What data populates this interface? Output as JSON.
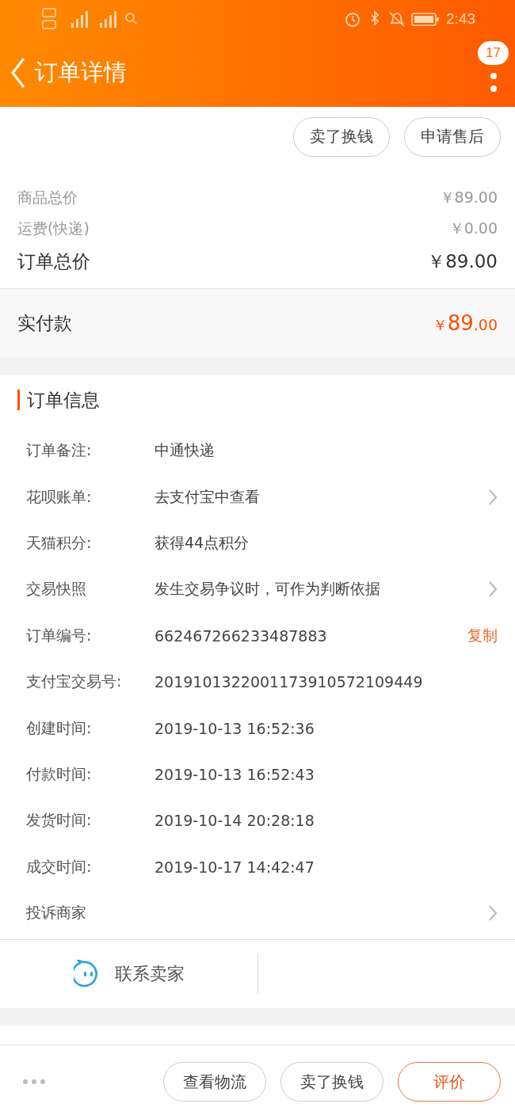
{
  "status_bar": {
    "time": "2:43"
  },
  "header": {
    "title": "订单详情",
    "badge": "17"
  },
  "top_actions": [
    "卖了换钱",
    "申请售后"
  ],
  "prices": [
    {
      "label": "商品总价",
      "value": "￥89.00",
      "kind": "minor"
    },
    {
      "label": "运费(快递)",
      "value": "￥0.00",
      "kind": "minor"
    },
    {
      "label": "订单总价",
      "value": "￥89.00",
      "kind": "major"
    }
  ],
  "paid": {
    "label": "实付款",
    "currency": "￥",
    "integer": "89",
    "decimal": ".00"
  },
  "order_info": {
    "title": "订单信息",
    "rows": [
      {
        "label": "订单备注:",
        "value": "中通快递",
        "kind": "plain"
      },
      {
        "label": "花呗账单:",
        "value": "去支付宝中查看",
        "kind": "link"
      },
      {
        "label": "天猫积分:",
        "value": "获得44点积分",
        "kind": "plain"
      },
      {
        "label": "交易快照",
        "value": "发生交易争议时，可作为判断依据",
        "kind": "link"
      },
      {
        "label": "订单编号:",
        "value": "662467266233487883",
        "kind": "copy",
        "action": "复制"
      },
      {
        "label": "支付宝交易号:",
        "value": "2019101322001173910572109449",
        "kind": "plain"
      },
      {
        "label": "创建时间:",
        "value": "2019-10-13 16:52:36",
        "kind": "plain"
      },
      {
        "label": "付款时间:",
        "value": "2019-10-13 16:52:43",
        "kind": "plain"
      },
      {
        "label": "发货时间:",
        "value": "2019-10-14 20:28:18",
        "kind": "plain"
      },
      {
        "label": "成交时间:",
        "value": "2019-10-17 14:42:47",
        "kind": "plain"
      },
      {
        "label": "投诉商家",
        "kind": "link"
      }
    ]
  },
  "contact": {
    "label": "联系卖家"
  },
  "bottom_actions": [
    {
      "label": "查看物流",
      "kind": "default"
    },
    {
      "label": "卖了换钱",
      "kind": "default"
    },
    {
      "label": "评价",
      "kind": "primary"
    }
  ]
}
